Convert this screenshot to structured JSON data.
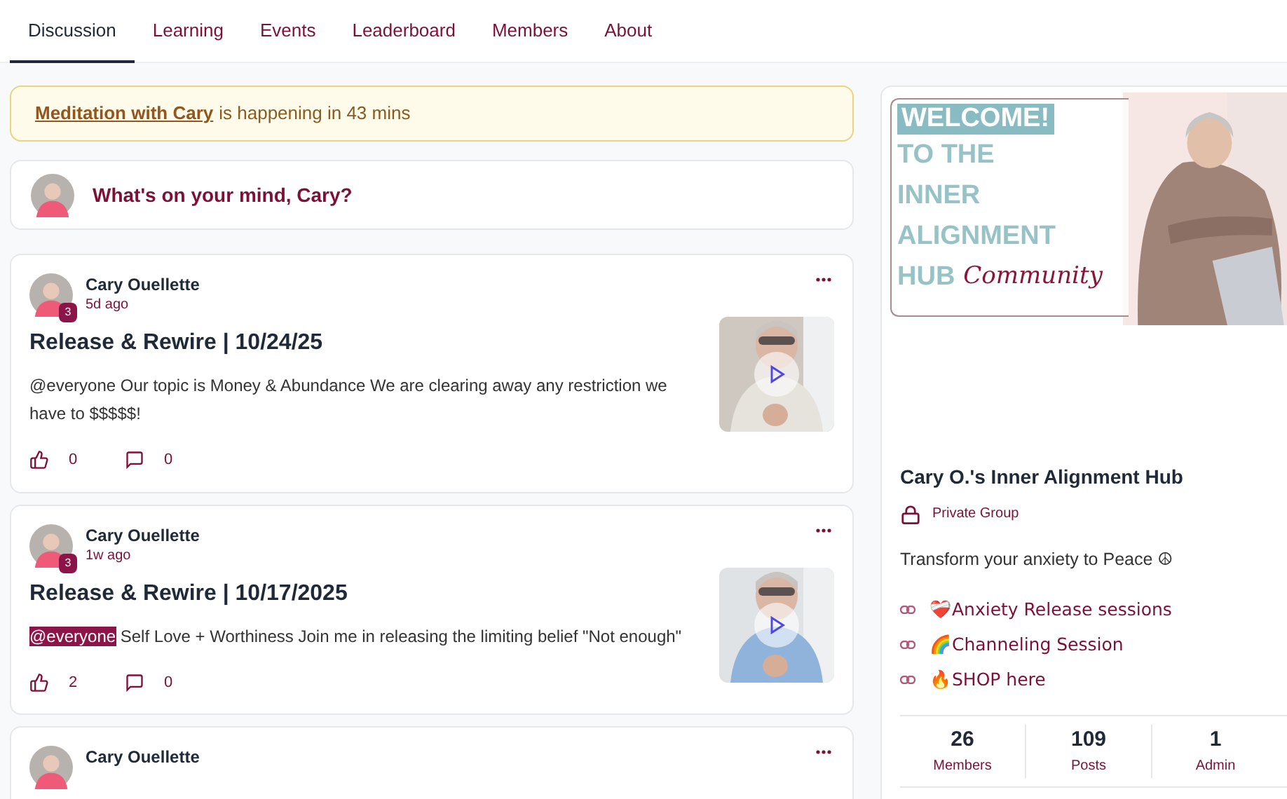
{
  "tabs": [
    {
      "label": "Discussion",
      "selected": true
    },
    {
      "label": "Learning",
      "selected": false
    },
    {
      "label": "Events",
      "selected": false
    },
    {
      "label": "Leaderboard",
      "selected": false
    },
    {
      "label": "Members",
      "selected": false
    },
    {
      "label": "About",
      "selected": false
    }
  ],
  "alert": {
    "link": "Meditation with Cary",
    "text": "is happening in 43 mins"
  },
  "composer": {
    "placeholder": "What's on your mind, Cary?"
  },
  "posts": [
    {
      "author": "Cary Ouellette",
      "level_badge": "3",
      "time": "5d ago",
      "title": "Release & Rewire | 10/24/25",
      "mention": {
        "text": "@everyone",
        "highlighted": false
      },
      "body": "Our topic is Money & Abundance We are clearing away any restriction we have to $$$$$!",
      "likes": "0",
      "comments": "0"
    },
    {
      "author": "Cary Ouellette",
      "level_badge": "3",
      "time": "1w ago",
      "title": "Release & Rewire | 10/17/2025",
      "mention": {
        "text": "@everyone",
        "highlighted": true
      },
      "body": "Self Love + Worthiness Join me in releasing the limiting belief \"Not enough\"",
      "likes": "2",
      "comments": "0"
    },
    {
      "author": "Cary Ouellette"
    }
  ],
  "group": {
    "banner": {
      "welcome": "WELCOME!",
      "lines": [
        "TO THE",
        "INNER",
        "ALIGNMENT",
        "HUB"
      ],
      "script": "Community"
    },
    "name": "Cary O.'s Inner Alignment Hub",
    "privacy": "Private Group",
    "description": "Transform your anxiety to Peace ☮",
    "links": [
      "❤️‍🩹Anxiety Release sessions",
      "🌈Channeling Session",
      "🔥SHOP here"
    ],
    "stats": [
      {
        "value": "26",
        "label": "Members"
      },
      {
        "value": "109",
        "label": "Posts"
      },
      {
        "value": "1",
        "label": "Admin"
      }
    ]
  }
}
